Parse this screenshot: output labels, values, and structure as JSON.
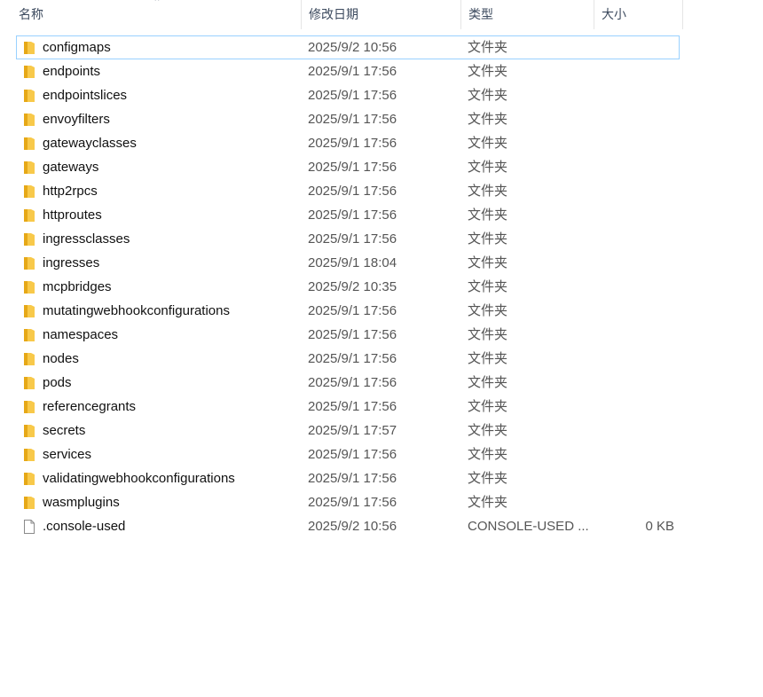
{
  "columns": {
    "name": "名称",
    "date": "修改日期",
    "type": "类型",
    "size": "大小"
  },
  "sort_icon": "sort-ascending-caret-icon",
  "files": [
    {
      "name": "configmaps",
      "date": "2025/9/2 10:56",
      "type": "文件夹",
      "size": "",
      "icon": "folder-icon",
      "focused": true
    },
    {
      "name": "endpoints",
      "date": "2025/9/1 17:56",
      "type": "文件夹",
      "size": "",
      "icon": "folder-icon"
    },
    {
      "name": "endpointslices",
      "date": "2025/9/1 17:56",
      "type": "文件夹",
      "size": "",
      "icon": "folder-icon"
    },
    {
      "name": "envoyfilters",
      "date": "2025/9/1 17:56",
      "type": "文件夹",
      "size": "",
      "icon": "folder-icon"
    },
    {
      "name": "gatewayclasses",
      "date": "2025/9/1 17:56",
      "type": "文件夹",
      "size": "",
      "icon": "folder-icon"
    },
    {
      "name": "gateways",
      "date": "2025/9/1 17:56",
      "type": "文件夹",
      "size": "",
      "icon": "folder-icon"
    },
    {
      "name": "http2rpcs",
      "date": "2025/9/1 17:56",
      "type": "文件夹",
      "size": "",
      "icon": "folder-icon"
    },
    {
      "name": "httproutes",
      "date": "2025/9/1 17:56",
      "type": "文件夹",
      "size": "",
      "icon": "folder-icon"
    },
    {
      "name": "ingressclasses",
      "date": "2025/9/1 17:56",
      "type": "文件夹",
      "size": "",
      "icon": "folder-icon"
    },
    {
      "name": "ingresses",
      "date": "2025/9/1 18:04",
      "type": "文件夹",
      "size": "",
      "icon": "folder-icon"
    },
    {
      "name": "mcpbridges",
      "date": "2025/9/2 10:35",
      "type": "文件夹",
      "size": "",
      "icon": "folder-icon"
    },
    {
      "name": "mutatingwebhookconfigurations",
      "date": "2025/9/1 17:56",
      "type": "文件夹",
      "size": "",
      "icon": "folder-icon"
    },
    {
      "name": "namespaces",
      "date": "2025/9/1 17:56",
      "type": "文件夹",
      "size": "",
      "icon": "folder-icon"
    },
    {
      "name": "nodes",
      "date": "2025/9/1 17:56",
      "type": "文件夹",
      "size": "",
      "icon": "folder-icon"
    },
    {
      "name": "pods",
      "date": "2025/9/1 17:56",
      "type": "文件夹",
      "size": "",
      "icon": "folder-icon"
    },
    {
      "name": "referencegrants",
      "date": "2025/9/1 17:56",
      "type": "文件夹",
      "size": "",
      "icon": "folder-icon"
    },
    {
      "name": "secrets",
      "date": "2025/9/1 17:57",
      "type": "文件夹",
      "size": "",
      "icon": "folder-icon"
    },
    {
      "name": "services",
      "date": "2025/9/1 17:56",
      "type": "文件夹",
      "size": "",
      "icon": "folder-icon"
    },
    {
      "name": "validatingwebhookconfigurations",
      "date": "2025/9/1 17:56",
      "type": "文件夹",
      "size": "",
      "icon": "folder-icon"
    },
    {
      "name": "wasmplugins",
      "date": "2025/9/1 17:56",
      "type": "文件夹",
      "size": "",
      "icon": "folder-icon"
    },
    {
      "name": ".console-used",
      "date": "2025/9/2 10:56",
      "type": "CONSOLE-USED ...",
      "size": "0 KB",
      "icon": "file-icon"
    }
  ],
  "colors": {
    "folder": "#f8c94a",
    "folder_dark": "#e6a817",
    "focus_border": "#99d1ff",
    "header_text": "#3c4a5e"
  }
}
